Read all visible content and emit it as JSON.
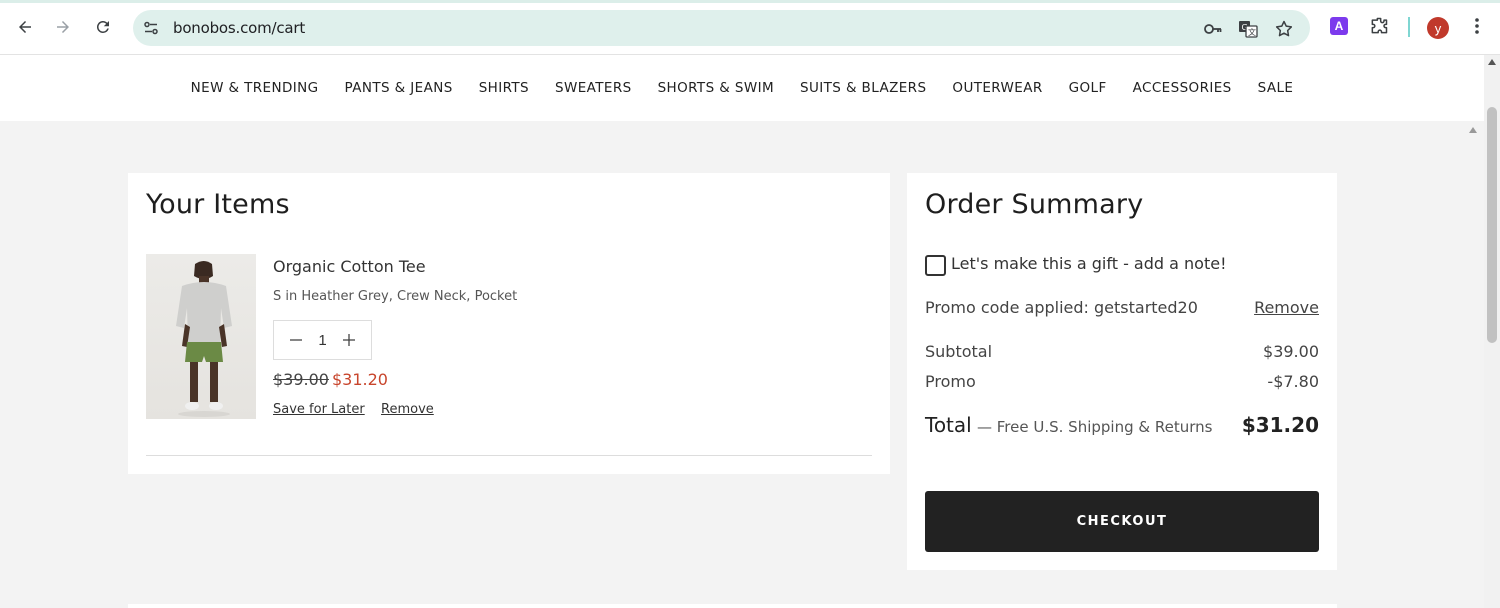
{
  "browser": {
    "url": "bonobos.com/cart",
    "profile_initial": "y",
    "extension_label": "A"
  },
  "nav": {
    "items": [
      "NEW & TRENDING",
      "PANTS & JEANS",
      "SHIRTS",
      "SWEATERS",
      "SHORTS & SWIM",
      "SUITS & BLAZERS",
      "OUTERWEAR",
      "GOLF",
      "ACCESSORIES",
      "SALE"
    ]
  },
  "items": {
    "title": "Your Items",
    "product": {
      "name": "Organic Cotton Tee",
      "variant": "S in Heather Grey, Crew Neck, Pocket",
      "quantity": "1",
      "original_price": "$39.00",
      "sale_price": "$31.20",
      "save_label": "Save for Later",
      "remove_label": "Remove"
    }
  },
  "summary": {
    "title": "Order Summary",
    "gift_label": "Let's make this a gift - add a note!",
    "promo_applied": "Promo code applied: getstarted20",
    "promo_remove": "Remove",
    "subtotal_label": "Subtotal",
    "subtotal_value": "$39.00",
    "promo_label": "Promo",
    "promo_value": "-$7.80",
    "total_label": "Total",
    "total_note": "— Free U.S. Shipping & Returns",
    "total_value": "$31.20",
    "checkout_label": "CHECKOUT"
  },
  "colors": {
    "sale_price": "#c8452c",
    "checkout_bg": "#222222",
    "omnibox_bg": "#dff0ec"
  }
}
